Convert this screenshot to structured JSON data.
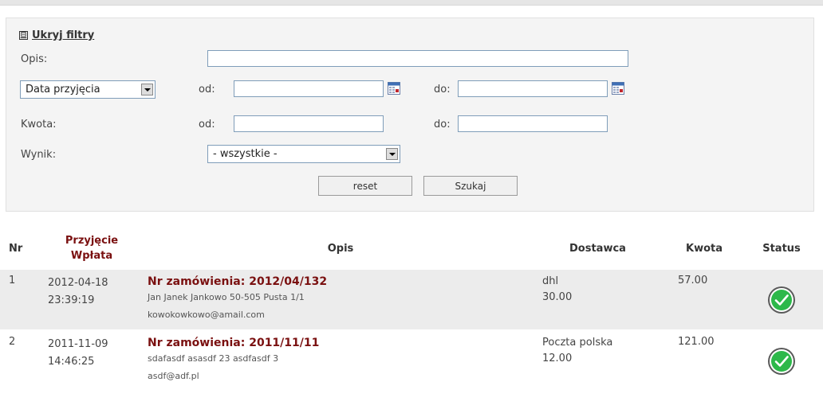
{
  "filters": {
    "toggle_icon": "⊟",
    "toggle_label": "Ukryj filtry",
    "opis_label": "Opis:",
    "opis_value": "",
    "date_select": "Data przyjęcia",
    "od_label": "od:",
    "do_label": "do:",
    "kwota_label": "Kwota:",
    "wynik_label": "Wynik:",
    "wynik_select": "- wszystkie -",
    "reset_button": "reset",
    "search_button": "Szukaj"
  },
  "table": {
    "headers": {
      "nr": "Nr",
      "przyjecie": "Przyjęcie",
      "wplata": "Wpłata",
      "opis": "Opis",
      "dostawca": "Dostawca",
      "kwota": "Kwota",
      "status": "Status"
    },
    "rows": [
      {
        "nr": "1",
        "date": "2012-04-18",
        "time": "23:39:19",
        "order": "Nr zamówienia: 2012/04/132",
        "address": "Jan Janek  Jankowo 50-505 Pusta 1/1",
        "email": "kowokowkowo@amail.com",
        "dostawca": "dhl",
        "dostawca_cost": "30.00",
        "kwota": "57.00",
        "status_icon": "check-circle-icon"
      },
      {
        "nr": "2",
        "date": "2011-11-09",
        "time": "14:46:25",
        "order": "Nr zamówienia: 2011/11/11",
        "address": "sdafasdf asasdf 23 asdfasdf 3",
        "email": "asdf@adf.pl",
        "dostawca": "Poczta polska",
        "dostawca_cost": "12.00",
        "kwota": "121.00",
        "status_icon": "check-circle-icon"
      }
    ]
  },
  "colors": {
    "accent_red": "#7a1010",
    "status_green": "#2db84a"
  }
}
